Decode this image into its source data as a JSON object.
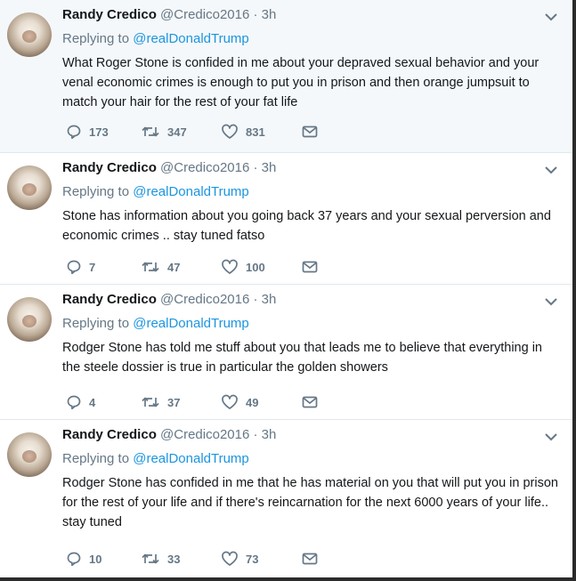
{
  "tweets": [
    {
      "name": "Randy Credico",
      "handle": "@Credico2016",
      "time": "· 3h",
      "replying_prefix": "Replying to ",
      "replying_to": "@realDonaldTrump",
      "text": "What Roger Stone is confided in me  about your depraved sexual behavior and your venal economic crimes is enough to put you in prison and then orange jumpsuit to match your hair for the rest of your fat life",
      "replies": "173",
      "retweets": "347",
      "likes": "831"
    },
    {
      "name": "Randy Credico",
      "handle": "@Credico2016",
      "time": "· 3h",
      "replying_prefix": "Replying to ",
      "replying_to": "@realDonaldTrump",
      "text": "Stone has information about you going back 37 years and your sexual perversion and economic crimes .. stay tuned fatso",
      "replies": "7",
      "retweets": "47",
      "likes": "100"
    },
    {
      "name": "Randy Credico",
      "handle": "@Credico2016",
      "time": "· 3h",
      "replying_prefix": "Replying to ",
      "replying_to": "@realDonaldTrump",
      "text": "Rodger Stone has told me stuff about you that leads me to believe that everything in the steele dossier is true in particular the golden showers",
      "replies": "4",
      "retweets": "37",
      "likes": "49"
    },
    {
      "name": "Randy Credico",
      "handle": "@Credico2016",
      "time": "· 3h",
      "replying_prefix": "Replying to ",
      "replying_to": "@realDonaldTrump",
      "text": "Rodger Stone has confided in me that he has material on you that will put you in prison for the rest of your life and if there's reincarnation for the next 6000 years of your life.. stay tuned",
      "replies": "10",
      "retweets": "33",
      "likes": "73"
    }
  ],
  "icons": {
    "reply": "reply-icon",
    "retweet": "retweet-icon",
    "like": "heart-icon",
    "dm": "envelope-icon",
    "more": "chevron-down-icon"
  },
  "colors": {
    "name": "#14171a",
    "secondary": "#657786",
    "mention": "#1b95e0",
    "highlight_bg": "#f5f8fa"
  }
}
